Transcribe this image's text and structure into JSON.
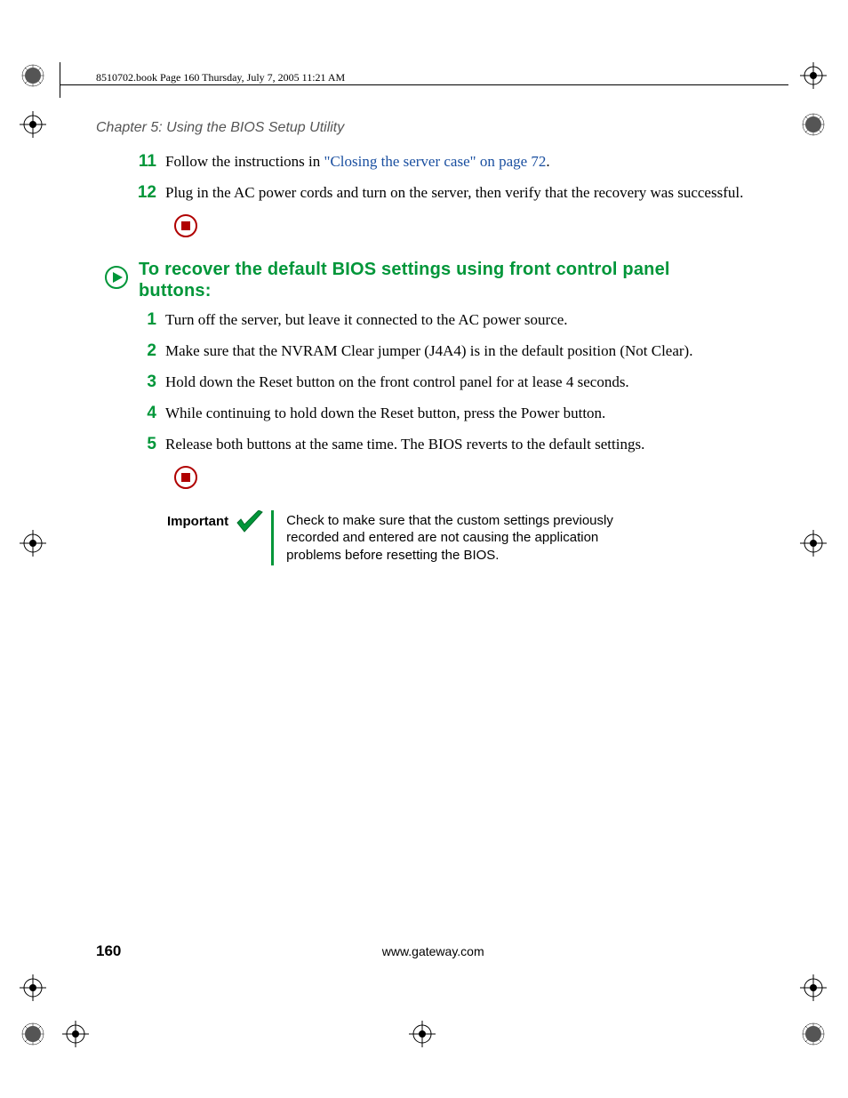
{
  "file_header": "8510702.book  Page 160  Thursday, July 7, 2005  11:21 AM",
  "chapter": "Chapter 5: Using the BIOS Setup Utility",
  "topList": [
    {
      "n": "11",
      "pre": "Follow the instructions in ",
      "link": "\"Closing the server case\" on page 72",
      "post": "."
    },
    {
      "n": "12",
      "text": "Plug in the AC power cords and turn on the server, then verify that the recovery was successful."
    }
  ],
  "heading": "To recover the default BIOS settings using front control panel buttons:",
  "steps": [
    {
      "n": "1",
      "text": "Turn off the server, but leave it connected to the AC power source."
    },
    {
      "n": "2",
      "text": "Make sure that the NVRAM Clear jumper (J4A4) is in the default position (Not Clear)."
    },
    {
      "n": "3",
      "text": "Hold down the Reset button on the front control panel for at lease 4 seconds."
    },
    {
      "n": "4",
      "text": "While continuing to hold down the Reset button, press the Power button."
    },
    {
      "n": "5",
      "text": "Release both buttons at the same time. The BIOS reverts to the default settings."
    }
  ],
  "important": {
    "label": "Important",
    "text": "Check to make sure that the custom settings previously recorded and entered are not causing the application problems before resetting the BIOS."
  },
  "footer": {
    "page": "160",
    "url": "www.gateway.com"
  }
}
